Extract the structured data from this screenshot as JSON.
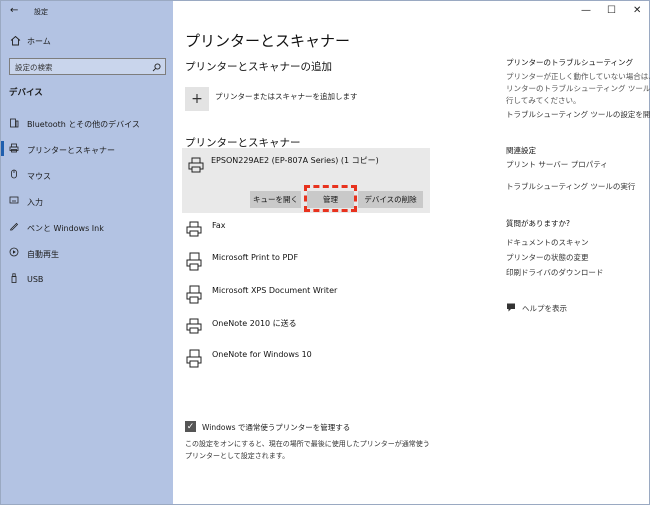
{
  "window": {
    "title": "設定",
    "back_glyph": "←",
    "minimize_glyph": "—",
    "maximize_glyph": "☐",
    "close_glyph": "✕"
  },
  "sidebar": {
    "home_label": "ホーム",
    "search_placeholder": "設定の検索",
    "section_title": "デバイス",
    "items": [
      {
        "label": "Bluetooth とその他のデバイス",
        "icon": "bluetooth-icon"
      },
      {
        "label": "プリンターとスキャナー",
        "icon": "printer-icon",
        "selected": true
      },
      {
        "label": "マウス",
        "icon": "mouse-icon"
      },
      {
        "label": "入力",
        "icon": "keyboard-icon"
      },
      {
        "label": "ペンと Windows Ink",
        "icon": "pen-icon"
      },
      {
        "label": "自動再生",
        "icon": "autoplay-icon"
      },
      {
        "label": "USB",
        "icon": "usb-icon"
      }
    ]
  },
  "main": {
    "title": "プリンターとスキャナー",
    "add_section_title": "プリンターとスキャナーの追加",
    "add_label": "プリンターまたはスキャナーを追加します",
    "list_title": "プリンターとスキャナー",
    "selected_printer": {
      "name": "EPSON229AE2 (EP-807A Series) (1 コピー)",
      "buttons": {
        "open_queue": "キューを開く",
        "manage": "管理",
        "remove": "デバイスの削除"
      }
    },
    "printers": [
      {
        "name": "Fax"
      },
      {
        "name": "Microsoft Print to PDF"
      },
      {
        "name": "Microsoft XPS Document Writer"
      },
      {
        "name": "OneNote 2010 に送る"
      },
      {
        "name": "OneNote for Windows 10"
      }
    ],
    "checkbox": {
      "label": "Windows で通常使うプリンターを管理する",
      "checked": true,
      "description_line1": "この設定をオンにすると、現在の場所で最後に使用したプリンターが通常使う",
      "description_line2": "プリンターとして設定されます。"
    }
  },
  "right_panel": {
    "troubleshoot_title": "プリンターのトラブルシューティング",
    "troubleshoot_text_line1": "プリンターが正しく動作していない場合は、プ",
    "troubleshoot_text_line2": "リンターのトラブルシューティング ツールを実",
    "troubleshoot_text_line3": "行してみてください。",
    "troubleshoot_link": "トラブルシューティング ツールの設定を開く",
    "related_title": "関連設定",
    "related_links": [
      "プリント サーバー プロパティ",
      "トラブルシューティング ツールの実行"
    ],
    "question_title": "質問がありますか?",
    "question_links": [
      "ドキュメントのスキャン",
      "プリンターの状態の変更",
      "印刷ドライバのダウンロード"
    ],
    "help_label": "ヘルプを表示"
  },
  "colors": {
    "sidebar_bg": "#b3c3e3",
    "highlight": "#e8321e",
    "selected_bar": "#1f5fae"
  }
}
